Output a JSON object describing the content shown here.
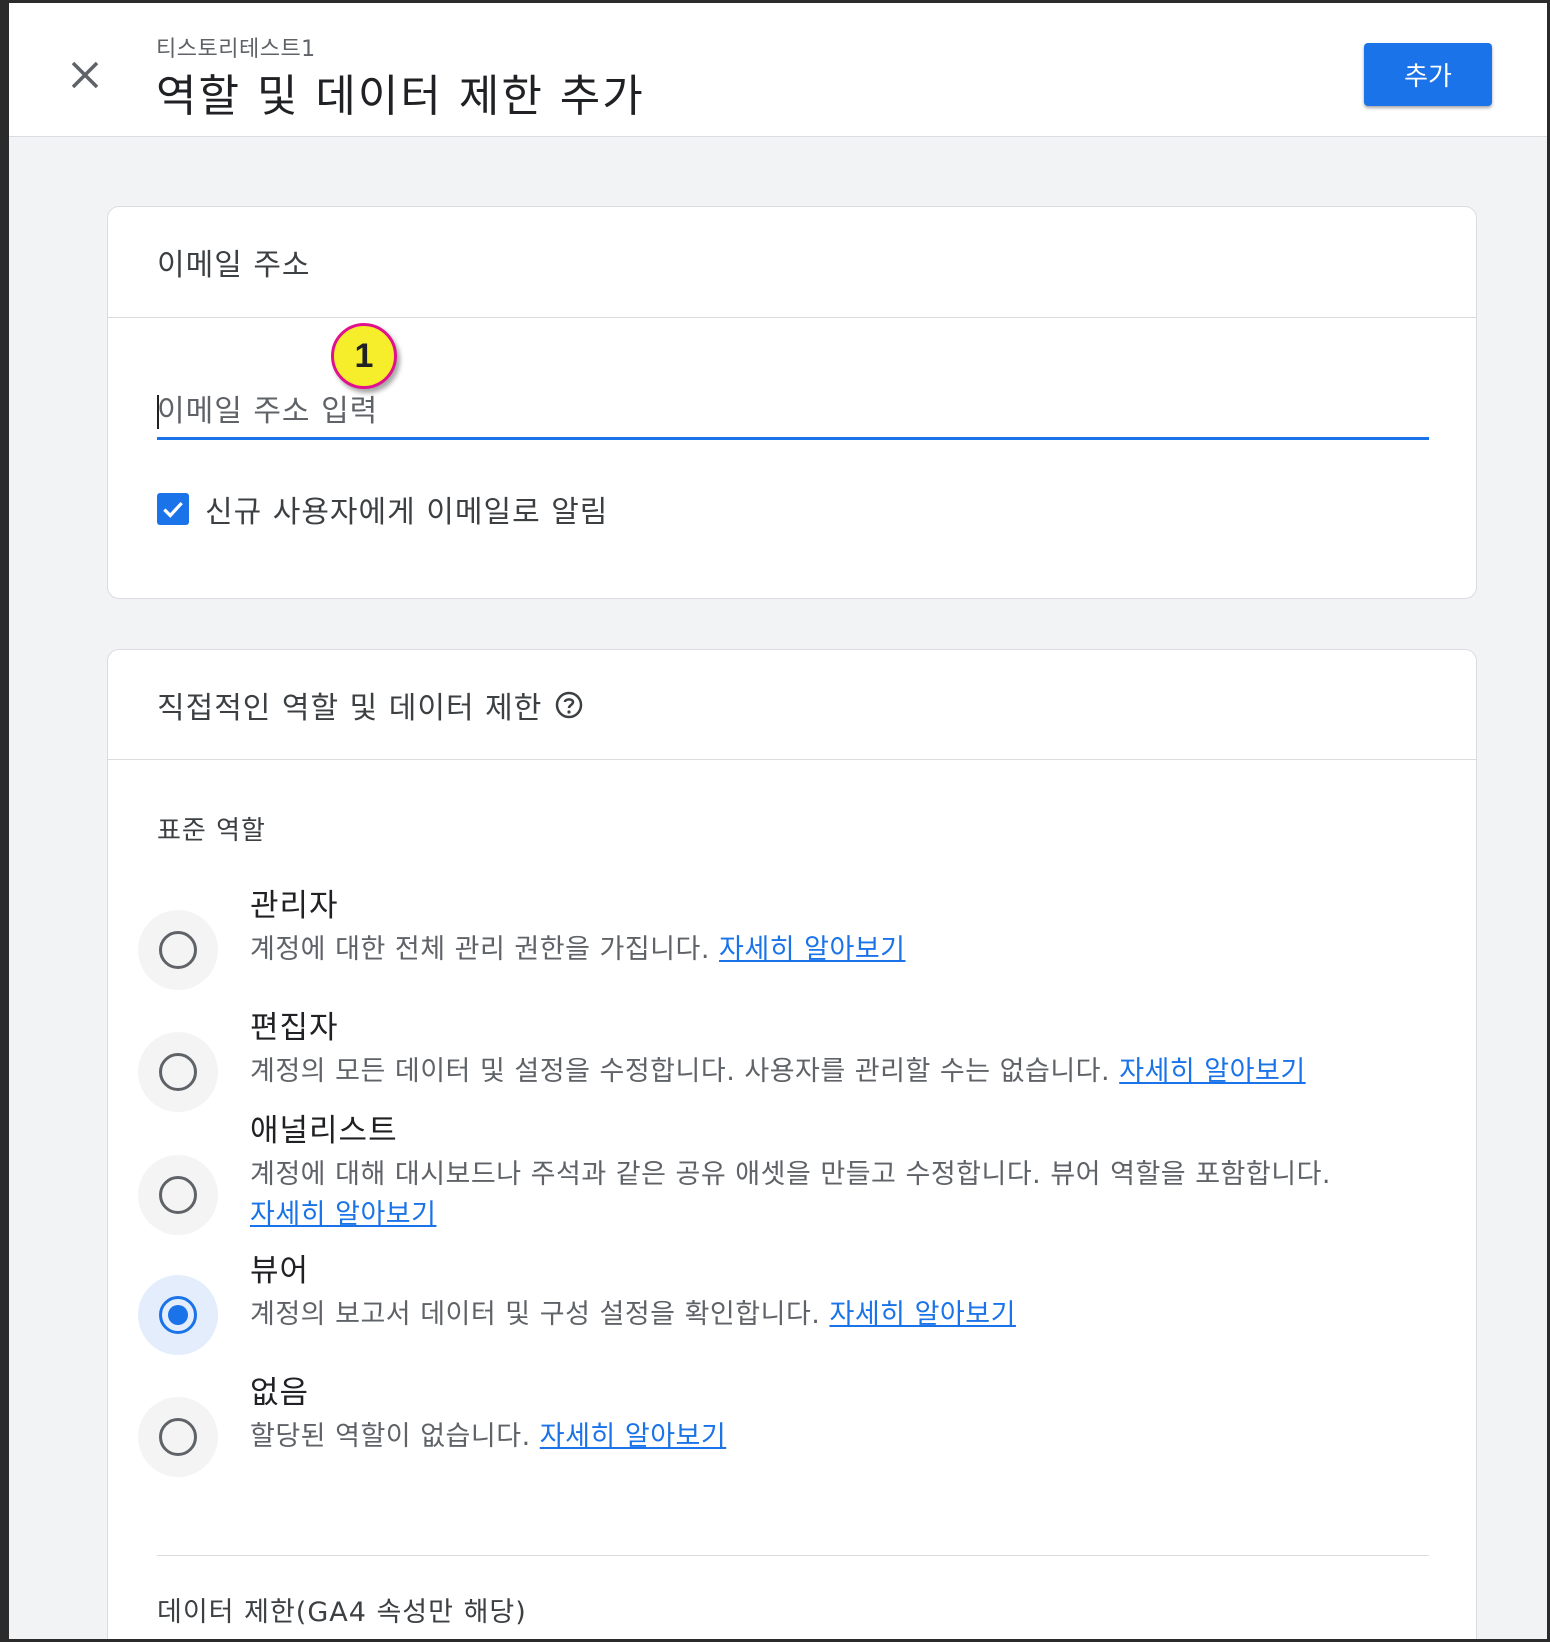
{
  "header": {
    "subtitle": "티스토리테스트1",
    "title": "역할 및 데이터 제한 추가",
    "add_label": "추가"
  },
  "email_card": {
    "heading": "이메일 주소",
    "input_placeholder": "이메일 주소 입력",
    "input_value": "",
    "badge": "1",
    "notify_label": "신규 사용자에게 이메일로 알림",
    "notify_checked": true
  },
  "roles_card": {
    "heading": "직접적인 역할 및 데이터 제한",
    "standard_roles_label": "표준 역할",
    "roles": [
      {
        "name": "관리자",
        "desc": "계정에 대한 전체 관리 권한을 가집니다.",
        "link": "자세히 알아보기",
        "selected": false
      },
      {
        "name": "편집자",
        "desc": "계정의 모든 데이터 및 설정을 수정합니다. 사용자를 관리할 수는 없습니다.",
        "link": "자세히 알아보기",
        "selected": false
      },
      {
        "name": "애널리스트",
        "desc": "계정에 대해 대시보드나 주석과 같은 공유 애셋을 만들고 수정합니다. 뷰어 역할을 포함합니다.",
        "link": "자세히 알아보기",
        "selected": false
      },
      {
        "name": "뷰어",
        "desc": "계정의 보고서 데이터 및 구성 설정을 확인합니다.",
        "link": "자세히 알아보기",
        "selected": true
      },
      {
        "name": "없음",
        "desc": "할당된 역할이 없습니다.",
        "link": "자세히 알아보기",
        "selected": false
      }
    ],
    "data_limit_label": "데이터 제한(GA4 속성만 해당)"
  },
  "colors": {
    "accent": "#1a73e8",
    "badge_fill": "#f7ee2b",
    "badge_border": "#e0118f"
  }
}
